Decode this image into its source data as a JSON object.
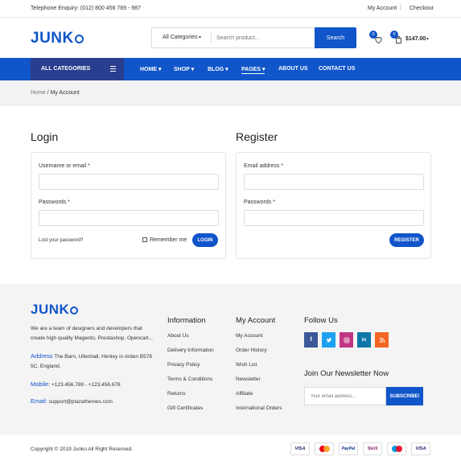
{
  "topbar": {
    "phone": "Telephone Enquiry: (012) 800 456 789 - 987",
    "my_account": "My Account",
    "separator": "|",
    "checkout": "Checkout"
  },
  "header": {
    "logo_text": "JUNK",
    "category_select": "All Categories",
    "search_placeholder": "Search product...",
    "search_button": "Search",
    "wishlist_count": "0",
    "cart_count": "0",
    "cart_total": "$147.00"
  },
  "nav": {
    "all_categories": "ALL CATEGORIES",
    "items": [
      {
        "label": "HOME"
      },
      {
        "label": "SHOP"
      },
      {
        "label": "BLOG"
      },
      {
        "label": "PAGES"
      },
      {
        "label": "ABOUT US"
      },
      {
        "label": "CONTACT US"
      }
    ]
  },
  "breadcrumb": {
    "home": "Home",
    "separator": "/",
    "current": "My Account"
  },
  "login": {
    "title": "Login",
    "username_label": "Username or email *",
    "password_label": "Passwords *",
    "lost_password": "Lost your password?",
    "remember_label": "Remember me",
    "button": "LOGIN"
  },
  "register": {
    "title": "Register",
    "email_label": "Email address *",
    "password_label": "Passwords *",
    "button": "REGISTER"
  },
  "footer": {
    "logo_text": "JUNK",
    "about": "We are a team of designers and developers that create high quality Magento, Prestashop, Opencart...",
    "address_label": "Address",
    "address_value": "The Barn, Ullenhall, Henley in Arden B578 5C, England.",
    "mobile_label": "Mobile:",
    "mobile_value": "+123.456.789 - +123.456.678",
    "email_label": "Email:",
    "email_value": "support@plazathemes.com",
    "information": {
      "title": "Information",
      "links": [
        "About Us",
        "Delivery Information",
        "Privacy Policy",
        "Terms & Conditions",
        "Returns",
        "Gift Certificates"
      ]
    },
    "my_account": {
      "title": "My Account",
      "links": [
        "My Account",
        "Order History",
        "Wish List",
        "Newsletter",
        "Affiliate",
        "International Orders"
      ]
    },
    "follow_us": {
      "title": "Follow Us",
      "icons": [
        "facebook-icon",
        "twitter-icon",
        "instagram-icon",
        "linkedin-icon",
        "rss-icon"
      ],
      "colors": [
        "#3b5998",
        "#1da1f2",
        "#c13584",
        "#0e76a8",
        "#f26522"
      ]
    },
    "newsletter": {
      "title": "Join Our Newsletter Now",
      "placeholder": "Your email address...",
      "button": "SUBSCRIBE!"
    },
    "copyright": "Copyright © 2019 Junko All Right Reserved.",
    "payments": [
      "VISA",
      "",
      "PayPal",
      "Skrill",
      "",
      "VISA"
    ]
  },
  "colors": {
    "brand": "#1055c9",
    "nav_dark": "#2a3e8f"
  }
}
